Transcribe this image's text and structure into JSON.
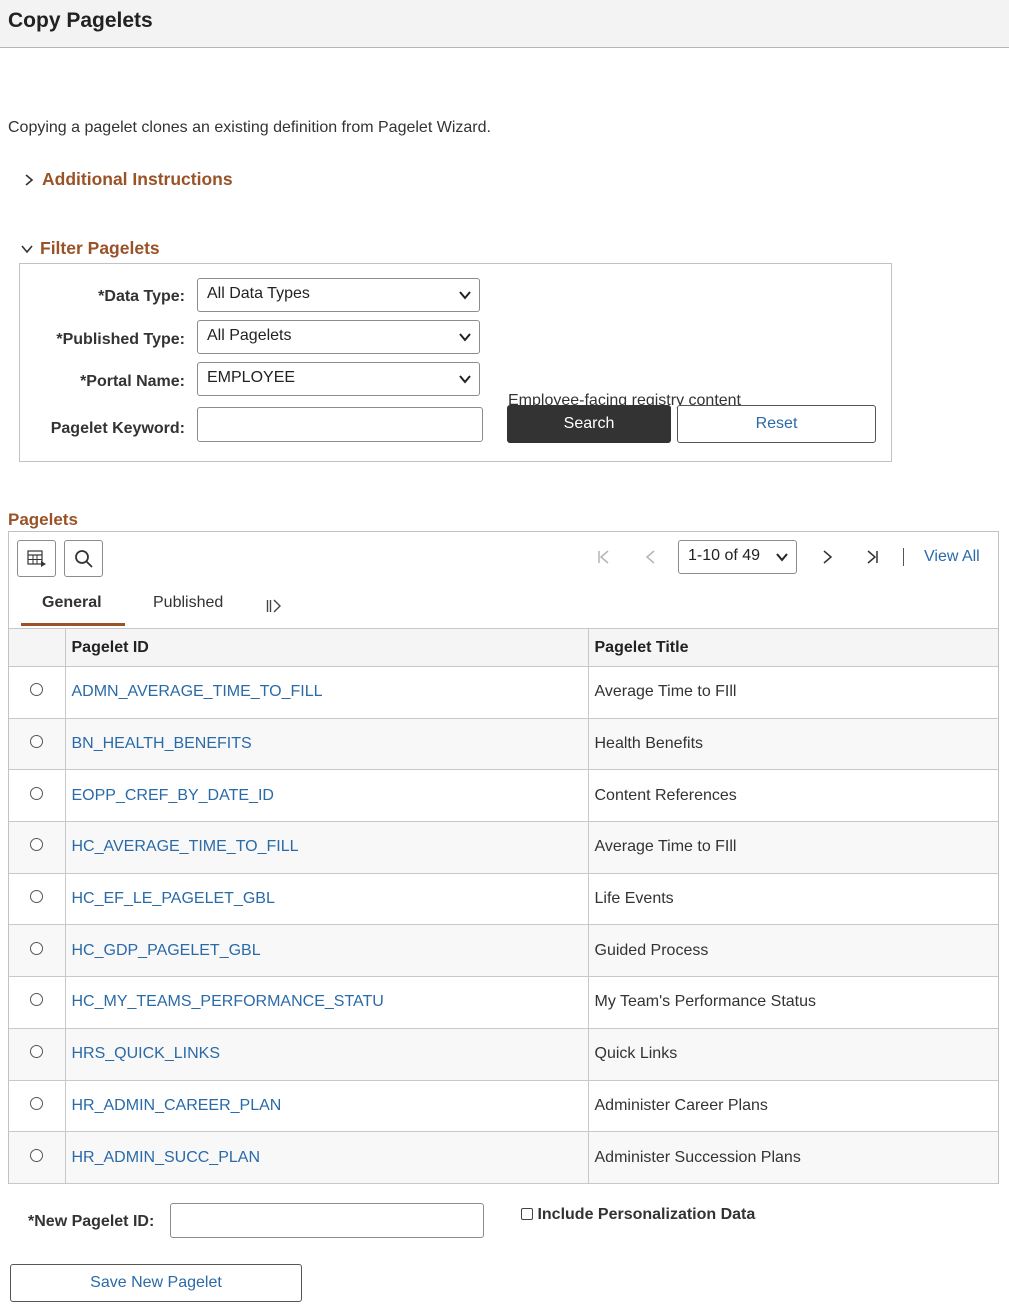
{
  "header": {
    "title": "Copy Pagelets"
  },
  "intro_text": "Copying a pagelet clones an existing definition from Pagelet Wizard.",
  "additional_instructions": {
    "label": "Additional Instructions"
  },
  "filter": {
    "title": "Filter Pagelets",
    "data_type": {
      "label": "Data Type:",
      "required": "*",
      "value": "All Data Types"
    },
    "published_type": {
      "label": "Published Type:",
      "required": "*",
      "value": "All Pagelets"
    },
    "portal_name": {
      "label": "Portal Name:",
      "required": "*",
      "value": "EMPLOYEE",
      "description": "Employee-facing registry content"
    },
    "keyword": {
      "label": "Pagelet Keyword:",
      "value": ""
    },
    "search_label": "Search",
    "reset_label": "Reset"
  },
  "pagelets": {
    "title": "Pagelets",
    "pagination": "1-10 of 49",
    "view_all": "View All",
    "tabs": [
      {
        "label": "General"
      },
      {
        "label": "Published"
      }
    ],
    "columns": {
      "id": "Pagelet ID",
      "title": "Pagelet Title"
    },
    "rows": [
      {
        "id": "ADMN_AVERAGE_TIME_TO_FILL",
        "title": "Average Time to FIll"
      },
      {
        "id": "BN_HEALTH_BENEFITS",
        "title": "Health Benefits"
      },
      {
        "id": "EOPP_CREF_BY_DATE_ID",
        "title": "Content References"
      },
      {
        "id": "HC_AVERAGE_TIME_TO_FILL",
        "title": "Average Time to FIll"
      },
      {
        "id": "HC_EF_LE_PAGELET_GBL",
        "title": "Life Events"
      },
      {
        "id": "HC_GDP_PAGELET_GBL",
        "title": "Guided Process"
      },
      {
        "id": "HC_MY_TEAMS_PERFORMANCE_STATU",
        "title": "My Team's Performance Status"
      },
      {
        "id": "HRS_QUICK_LINKS",
        "title": "Quick Links"
      },
      {
        "id": "HR_ADMIN_CAREER_PLAN",
        "title": "Administer Career Plans"
      },
      {
        "id": "HR_ADMIN_SUCC_PLAN",
        "title": "Administer Succession Plans"
      }
    ]
  },
  "new_pagelet": {
    "label": "New Pagelet ID:",
    "required": "*",
    "value": "",
    "include_personalization_label": "Include Personalization Data",
    "save_label": "Save New Pagelet"
  }
}
